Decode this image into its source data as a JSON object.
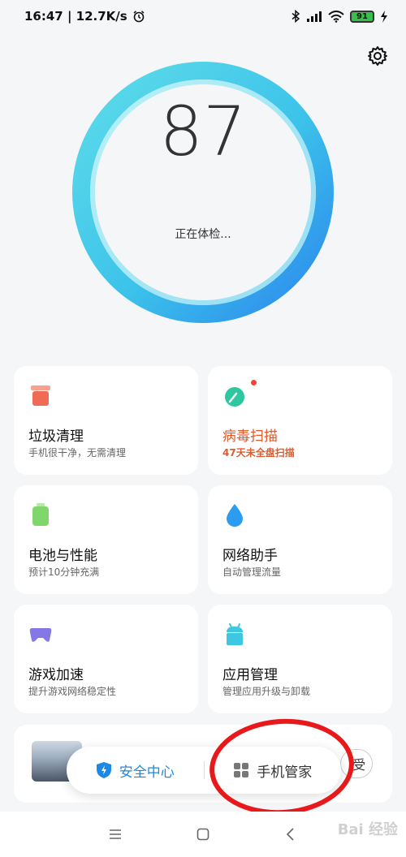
{
  "status_bar": {
    "time_speed": "16:47 | 12.7K/s",
    "battery_level": "91"
  },
  "score": {
    "value": "87",
    "status": "正在体检..."
  },
  "cards": [
    {
      "title": "垃圾清理",
      "subtitle": "手机很干净，无需清理",
      "icon": "trash-icon",
      "color": "#f06b55"
    },
    {
      "title": "病毒扫描",
      "subtitle": "47天未全盘扫描",
      "icon": "shield-scan-icon",
      "color": "#2fc79f",
      "warning": true
    },
    {
      "title": "电池与性能",
      "subtitle": "预计10分钟充满",
      "icon": "battery-icon",
      "color": "#7fd66a"
    },
    {
      "title": "网络助手",
      "subtitle": "自动管理流量",
      "icon": "water-drop-icon",
      "color": "#2b9cf0"
    },
    {
      "title": "游戏加速",
      "subtitle": "提升游戏网络稳定性",
      "icon": "gamepad-icon",
      "color": "#8477e6"
    },
    {
      "title": "应用管理",
      "subtitle": "管理应用升级与卸载",
      "icon": "android-icon",
      "color": "#3dc7e0"
    }
  ],
  "banner": {
    "button_label": "受"
  },
  "switcher": {
    "security_center": "安全中心",
    "phone_manager": "手机管家"
  },
  "watermark": "Bai 经验",
  "colors": {
    "accent_blue": "#1e88e5",
    "ring_start": "#4fd8e8",
    "ring_end": "#2f8ff0",
    "warning": "#e05a2b",
    "annotation_red": "#e8191a"
  }
}
